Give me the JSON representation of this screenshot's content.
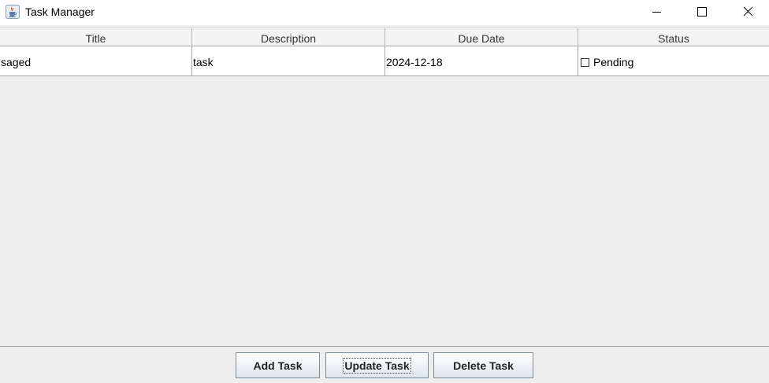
{
  "window": {
    "title": "Task Manager",
    "icon": "java-cup-icon"
  },
  "table": {
    "columns": [
      "Title",
      "Description",
      "Due Date",
      "Status"
    ],
    "rows": [
      {
        "title": "saged",
        "description": "task",
        "due_date": "2024-12-18",
        "status_checked": false,
        "status_label": "Pending"
      }
    ]
  },
  "buttons": {
    "add": "Add Task",
    "update": "Update Task",
    "delete": "Delete Task"
  }
}
